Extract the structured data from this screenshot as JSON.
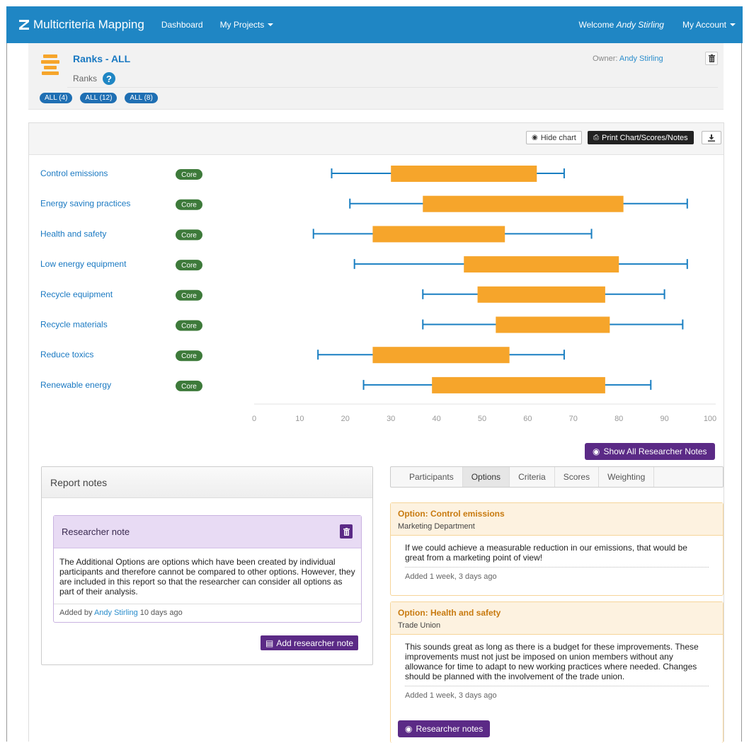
{
  "navbar": {
    "brand": "Multicriteria Mapping",
    "dashboard": "Dashboard",
    "my_projects": "My Projects",
    "welcome_prefix": "Welcome",
    "welcome_user": "Andy Stirling",
    "my_account": "My Account",
    "color": "#1f86c4"
  },
  "header": {
    "title": "Ranks - ALL",
    "subtitle": "Ranks",
    "owner_label": "Owner:",
    "owner_name": "Andy Stirling",
    "pills": [
      "ALL (4)",
      "ALL (12)",
      "ALL (8)"
    ]
  },
  "toolbar": {
    "hide_chart": "Hide chart",
    "print": "Print Chart/Scores/Notes"
  },
  "chart_data": {
    "type": "boxplot",
    "axis": {
      "min": 0,
      "max": 100,
      "ticks": [
        0,
        10,
        20,
        30,
        40,
        50,
        60,
        70,
        80,
        90,
        100
      ]
    },
    "badge_label": "Core",
    "colors": {
      "box": "#f6a52b",
      "whisker": "#1a7fc2",
      "badge": "#3d7a3a",
      "label": "#1a79c2"
    },
    "rows": [
      {
        "label": "Control emissions",
        "min": 17,
        "q1": 30,
        "q3": 62,
        "max": 68
      },
      {
        "label": "Energy saving practices",
        "min": 21,
        "q1": 37,
        "q3": 81,
        "max": 95
      },
      {
        "label": "Health and safety",
        "min": 13,
        "q1": 26,
        "q3": 55,
        "max": 74
      },
      {
        "label": "Low energy equipment",
        "min": 22,
        "q1": 46,
        "q3": 80,
        "max": 95
      },
      {
        "label": "Recycle equipment",
        "min": 37,
        "q1": 49,
        "q3": 77,
        "max": 90
      },
      {
        "label": "Recycle materials",
        "min": 37,
        "q1": 53,
        "q3": 78,
        "max": 94
      },
      {
        "label": "Reduce toxics",
        "min": 14,
        "q1": 26,
        "q3": 56,
        "max": 68
      },
      {
        "label": "Renewable energy",
        "min": 24,
        "q1": 39,
        "q3": 77,
        "max": 87
      }
    ]
  },
  "show_notes_button": "Show All Researcher Notes",
  "report": {
    "title": "Report notes",
    "note_title": "Researcher note",
    "note_body": "The Additional Options are options which have been created by individual participants and therefore cannot be compared to other options. However, they are included in this report so that the researcher can consider all options as part of their analysis.",
    "added_by_prefix": "Added by",
    "added_by_name": "Andy Stirling",
    "added_by_suffix": "10 days ago",
    "add_button": "Add researcher note"
  },
  "tabs": [
    "Participants",
    "Options",
    "Criteria",
    "Scores",
    "Weighting"
  ],
  "active_tab": "Options",
  "cards": [
    {
      "title": "Option: Control emissions",
      "group": "Marketing Department",
      "body": "If we could achieve a measurable reduction in our emissions, that would be great from a marketing point of view!",
      "meta": "Added 1 week, 3 days ago"
    },
    {
      "title": "Option: Health and safety",
      "group": "Trade Union",
      "body": "This sounds great as long as there is a budget for these improvements. These improvements must not just be imposed on union members without any allowance for time to adapt to new working practices where needed. Changes should be planned with the involvement of the trade union.",
      "meta": "Added 1 week, 3 days ago",
      "button": "Researcher notes"
    }
  ]
}
